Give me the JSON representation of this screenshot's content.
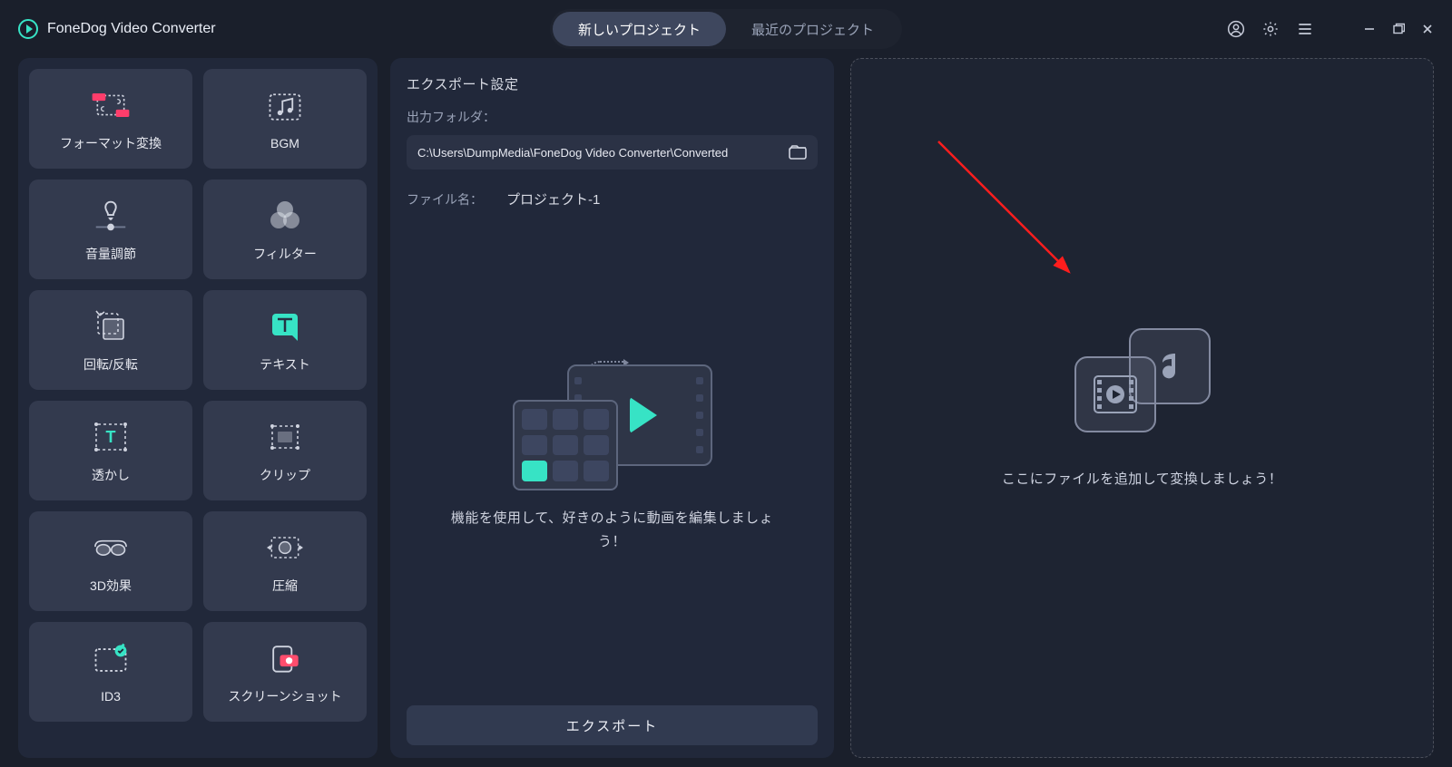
{
  "app": {
    "title": "FoneDog Video Converter"
  },
  "tabs": {
    "new_project": "新しいプロジェクト",
    "recent_projects": "最近のプロジェクト"
  },
  "tools": [
    {
      "id": "format",
      "label": "フォーマット変換"
    },
    {
      "id": "bgm",
      "label": "BGM"
    },
    {
      "id": "volume",
      "label": "音量調節"
    },
    {
      "id": "filter",
      "label": "フィルター"
    },
    {
      "id": "rotate",
      "label": "回転/反転"
    },
    {
      "id": "text",
      "label": "テキスト"
    },
    {
      "id": "watermark",
      "label": "透かし"
    },
    {
      "id": "clip",
      "label": "クリップ"
    },
    {
      "id": "3d",
      "label": "3D効果"
    },
    {
      "id": "compress",
      "label": "圧縮"
    },
    {
      "id": "id3",
      "label": "ID3"
    },
    {
      "id": "screenshot",
      "label": "スクリーンショット"
    }
  ],
  "export": {
    "section_title": "エクスポート設定",
    "output_folder_label": "出力フォルダ：",
    "output_folder_path": "C:\\Users\\DumpMedia\\FoneDog Video Converter\\Converted",
    "file_name_label": "ファイル名：",
    "file_name_value": "プロジェクト-1",
    "hint": "機能を使用して、好きのように動画を編集しましょう！",
    "export_button": "エクスポート"
  },
  "dropzone": {
    "hint": "ここにファイルを追加して変換しましょう！"
  }
}
